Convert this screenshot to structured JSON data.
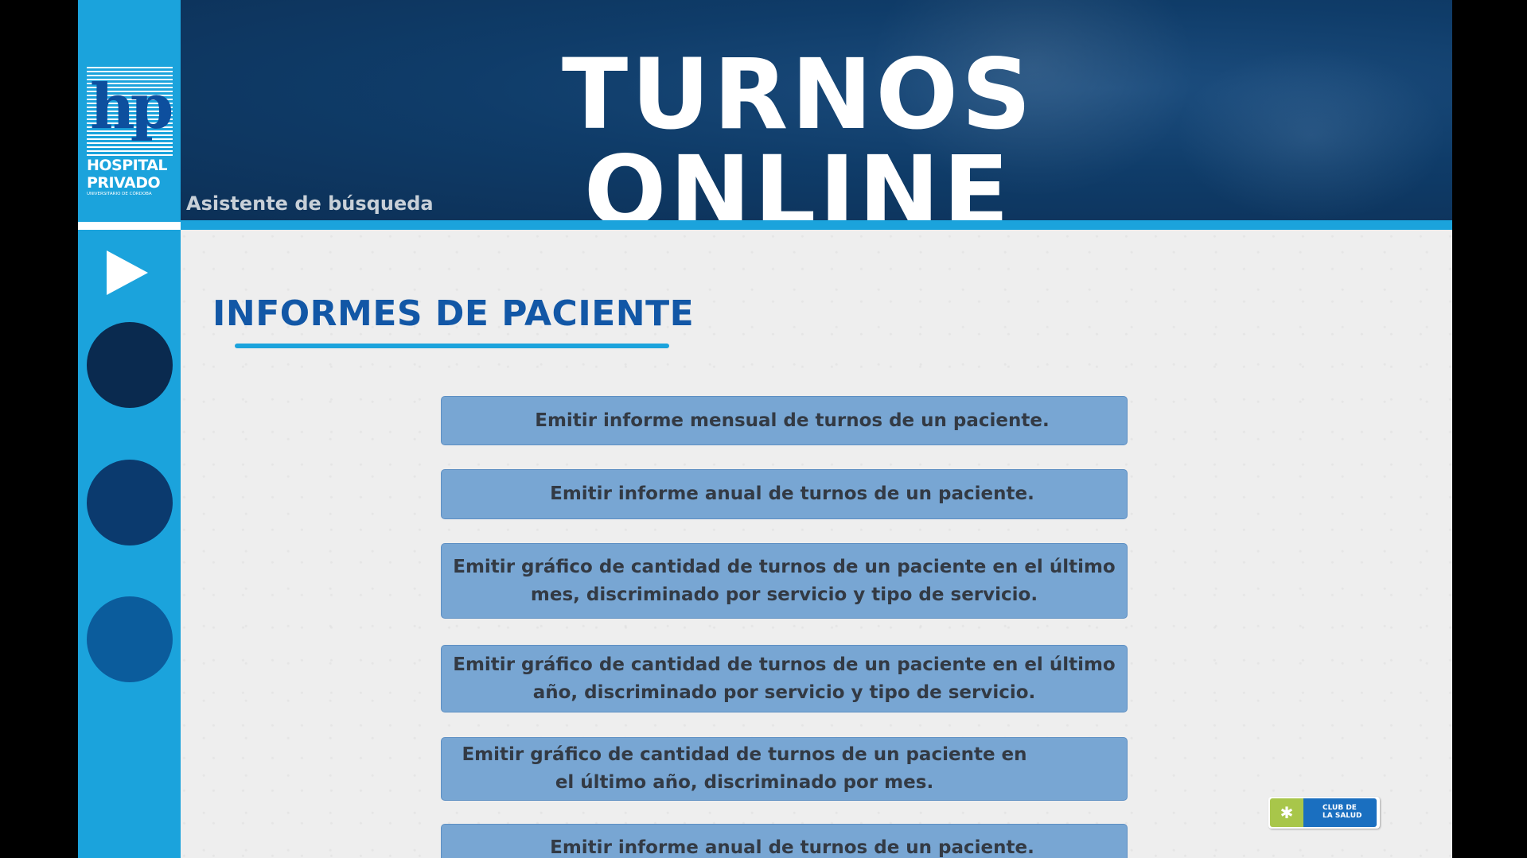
{
  "header": {
    "title": "TURNOS ONLINE",
    "subtitle": "Asistente de búsqueda"
  },
  "logo": {
    "name_line1": "HOSPITAL",
    "name_line2": "PRIVADO",
    "tagline": "UNIVERSITARIO DE CÓRDOBA",
    "monogram": "hp"
  },
  "section": {
    "title": "INFORMES DE PACIENTE"
  },
  "options": [
    "Emitir informe mensual de turnos de un paciente.",
    "Emitir informe anual de turnos de un paciente.",
    "Emitir gráfico de cantidad de turnos de un paciente en el último mes, discriminado por servicio y tipo de servicio.",
    "Emitir gráfico de cantidad de turnos de un paciente en el último año, discriminado por servicio y tipo de servicio.",
    "Emitir gráfico de cantidad de turnos de un paciente en el último año, discriminado por mes.",
    "Emitir informe anual de turnos de un paciente."
  ],
  "badge": {
    "text": "CLUB DE\nLA SALUD"
  },
  "colors": {
    "accent": "#1ba3dc",
    "header_bg": "#0f3c69",
    "title_blue": "#1257a6",
    "option_bg": "#78a6d3",
    "nav_circle_1": "#0a2a4f",
    "nav_circle_2": "#0b3a6e",
    "nav_circle_3": "#0b5c9c"
  }
}
